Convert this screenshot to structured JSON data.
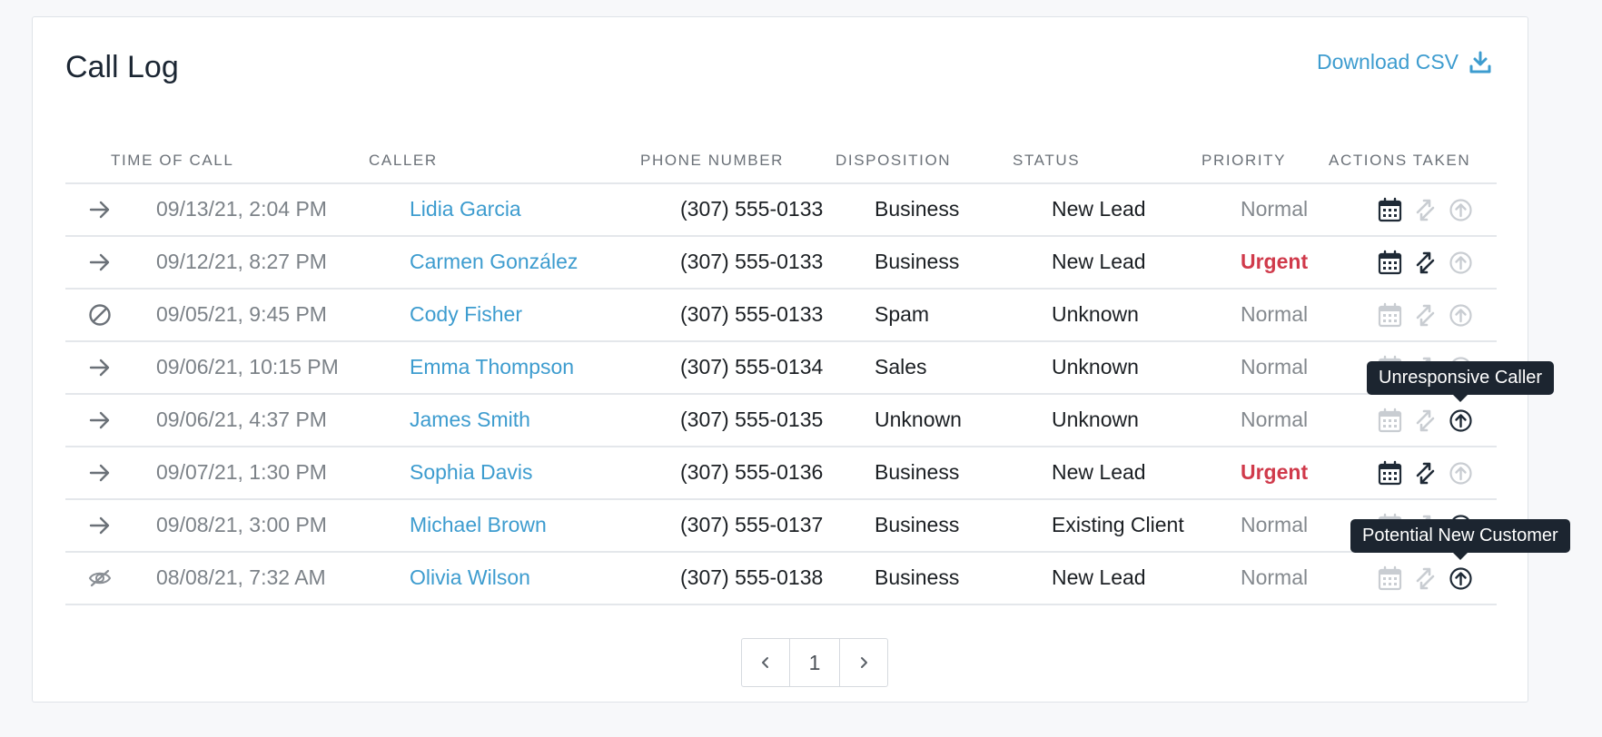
{
  "header": {
    "title": "Call Log",
    "download_label": "Download CSV"
  },
  "columns": [
    "TIME OF CALL",
    "CALLER",
    "PHONE NUMBER",
    "DISPOSITION",
    "STATUS",
    "PRIORITY",
    "ACTIONS TAKEN"
  ],
  "rows": [
    {
      "direction_icon": "arrow-right-icon",
      "time": "09/13/21, 2:04 PM",
      "caller": "Lidia Garcia",
      "phone": "(307) 555-0133",
      "disposition": "Business",
      "status": "New Lead",
      "priority": "Normal",
      "actions": {
        "calendar": true,
        "transfer": false,
        "escalate": false
      }
    },
    {
      "direction_icon": "arrow-right-icon",
      "time": "09/12/21, 8:27 PM",
      "caller": "Carmen González",
      "phone": "(307) 555-0133",
      "disposition": "Business",
      "status": "New Lead",
      "priority": "Urgent",
      "actions": {
        "calendar": true,
        "transfer": true,
        "escalate": false
      }
    },
    {
      "direction_icon": "blocked-icon",
      "time": "09/05/21, 9:45 PM",
      "caller": "Cody Fisher",
      "phone": "(307) 555-0133",
      "disposition": "Spam",
      "status": "Unknown",
      "priority": "Normal",
      "actions": {
        "calendar": false,
        "transfer": false,
        "escalate": false
      }
    },
    {
      "direction_icon": "arrow-right-icon",
      "time": "09/06/21, 10:15 PM",
      "caller": "Emma Thompson",
      "phone": "(307) 555-0134",
      "disposition": "Sales",
      "status": "Unknown",
      "priority": "Normal",
      "actions": {
        "calendar": false,
        "transfer": false,
        "escalate": false
      }
    },
    {
      "direction_icon": "arrow-right-icon",
      "time": "09/06/21, 4:37 PM",
      "caller": "James Smith",
      "phone": "(307) 555-0135",
      "disposition": "Unknown",
      "status": "Unknown",
      "priority": "Normal",
      "actions": {
        "calendar": false,
        "transfer": false,
        "escalate": true
      }
    },
    {
      "direction_icon": "arrow-right-icon",
      "time": "09/07/21, 1:30 PM",
      "caller": "Sophia Davis",
      "phone": "(307) 555-0136",
      "disposition": "Business",
      "status": "New Lead",
      "priority": "Urgent",
      "actions": {
        "calendar": true,
        "transfer": true,
        "escalate": false
      }
    },
    {
      "direction_icon": "arrow-right-icon",
      "time": "09/08/21, 3:00 PM",
      "caller": "Michael Brown",
      "phone": "(307) 555-0137",
      "disposition": "Business",
      "status": "Existing Client",
      "priority": "Normal",
      "actions": {
        "calendar": false,
        "transfer": false,
        "escalate": true
      }
    },
    {
      "direction_icon": "hidden-eye-icon",
      "time": "08/08/21, 7:32 AM",
      "caller": "Olivia Wilson",
      "phone": "(307) 555-0138",
      "disposition": "Business",
      "status": "New Lead",
      "priority": "Normal",
      "actions": {
        "calendar": false,
        "transfer": false,
        "escalate": true
      }
    }
  ],
  "tooltips": [
    {
      "text": "Unresponsive Caller",
      "row_index": 4
    },
    {
      "text": "Potential New Customer",
      "row_index": 7
    }
  ],
  "pagination": {
    "prev_icon": "chevron-left-icon",
    "page": "1",
    "next_icon": "chevron-right-icon"
  },
  "colors": {
    "link": "#3d9ccf",
    "urgent": "#d03a4b",
    "muted": "#7c8288",
    "tooltip_bg": "#1c2530"
  }
}
